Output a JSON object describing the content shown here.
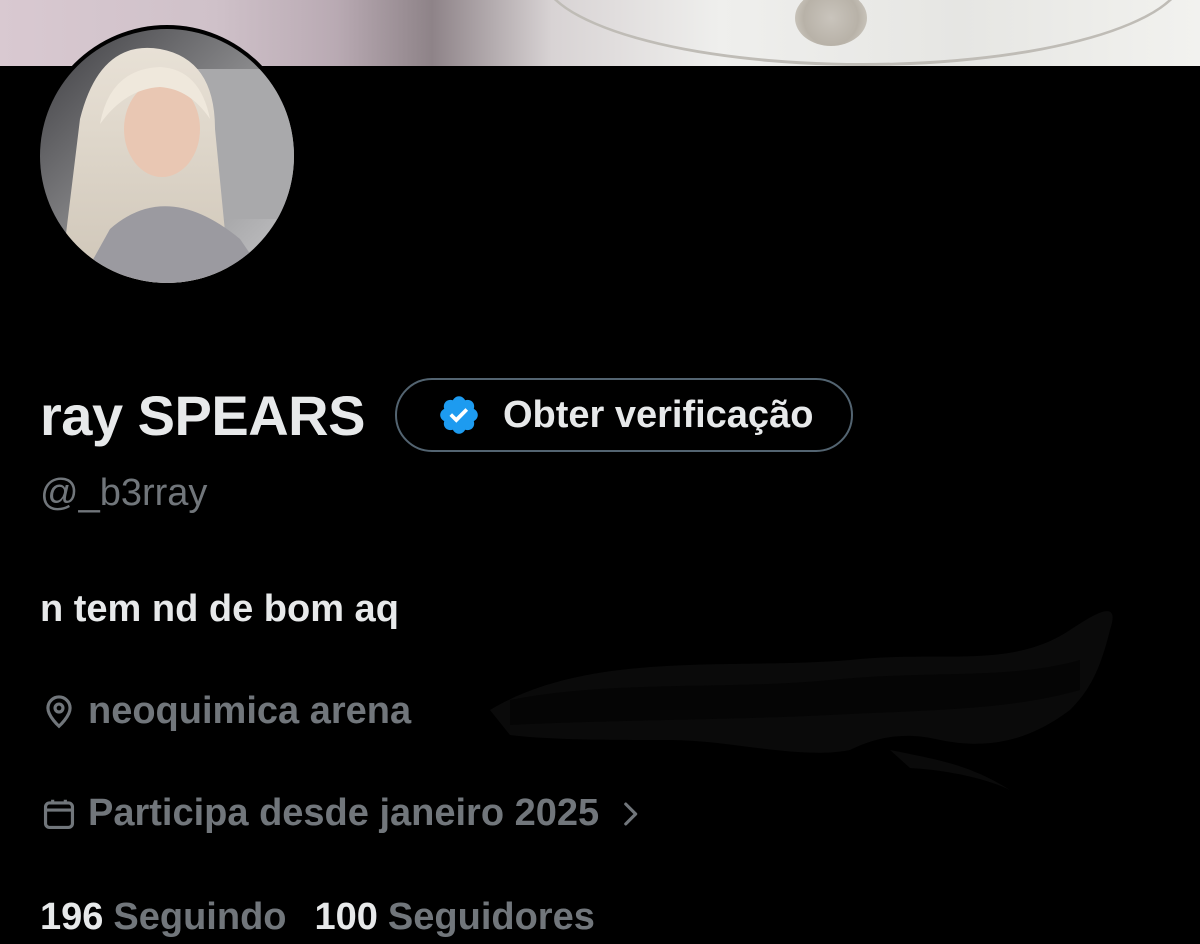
{
  "profile": {
    "display_name": "ray SPEARS",
    "handle": "@_b3rray",
    "bio": "n tem nd de bom aq",
    "location": "neoquimica arena",
    "joined": "Participa desde janeiro 2025"
  },
  "verification": {
    "label": "Obter verificação",
    "badge_color": "#1d9bf0"
  },
  "stats": {
    "following_count": "196",
    "following_label": "Seguindo",
    "followers_count": "100",
    "followers_label": "Seguidores"
  },
  "icons": {
    "location": "location-pin-icon",
    "calendar": "calendar-icon",
    "chevron": "chevron-right-icon",
    "verified": "verified-badge-icon"
  },
  "colors": {
    "background": "#000000",
    "primary_text": "#e7e9ea",
    "secondary_text": "#71767b",
    "accent": "#1d9bf0"
  }
}
